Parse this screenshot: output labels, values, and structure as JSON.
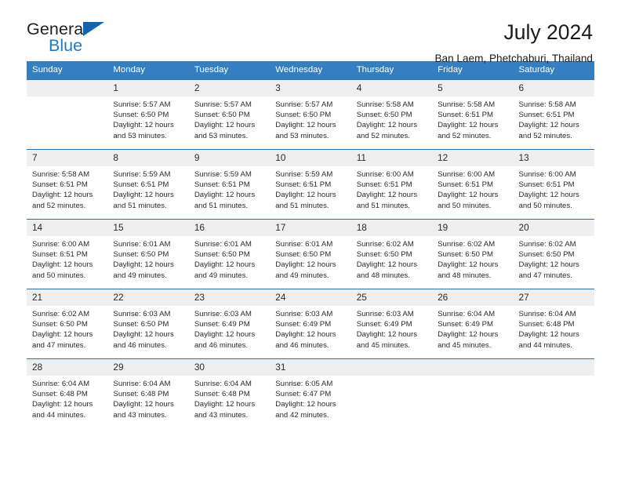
{
  "logo": {
    "word_one": "General",
    "word_two": "Blue",
    "triangle_color": "#1265ac",
    "blue_color": "#1f7ac4"
  },
  "header": {
    "title": "July 2024",
    "subtitle": "Ban Laem, Phetchaburi, Thailand"
  },
  "theme": {
    "header_blue": "#357ec0",
    "rule_blue": "#1f6bb0",
    "daynum_gray": "#efefef"
  },
  "weekdays": [
    "Sunday",
    "Monday",
    "Tuesday",
    "Wednesday",
    "Thursday",
    "Friday",
    "Saturday"
  ],
  "weeks": [
    [
      {
        "day": "",
        "text": ""
      },
      {
        "day": "1",
        "text": "Sunrise: 5:57 AM\nSunset: 6:50 PM\nDaylight: 12 hours\nand 53 minutes."
      },
      {
        "day": "2",
        "text": "Sunrise: 5:57 AM\nSunset: 6:50 PM\nDaylight: 12 hours\nand 53 minutes."
      },
      {
        "day": "3",
        "text": "Sunrise: 5:57 AM\nSunset: 6:50 PM\nDaylight: 12 hours\nand 53 minutes."
      },
      {
        "day": "4",
        "text": "Sunrise: 5:58 AM\nSunset: 6:50 PM\nDaylight: 12 hours\nand 52 minutes."
      },
      {
        "day": "5",
        "text": "Sunrise: 5:58 AM\nSunset: 6:51 PM\nDaylight: 12 hours\nand 52 minutes."
      },
      {
        "day": "6",
        "text": "Sunrise: 5:58 AM\nSunset: 6:51 PM\nDaylight: 12 hours\nand 52 minutes."
      }
    ],
    [
      {
        "day": "7",
        "text": "Sunrise: 5:58 AM\nSunset: 6:51 PM\nDaylight: 12 hours\nand 52 minutes."
      },
      {
        "day": "8",
        "text": "Sunrise: 5:59 AM\nSunset: 6:51 PM\nDaylight: 12 hours\nand 51 minutes."
      },
      {
        "day": "9",
        "text": "Sunrise: 5:59 AM\nSunset: 6:51 PM\nDaylight: 12 hours\nand 51 minutes."
      },
      {
        "day": "10",
        "text": "Sunrise: 5:59 AM\nSunset: 6:51 PM\nDaylight: 12 hours\nand 51 minutes."
      },
      {
        "day": "11",
        "text": "Sunrise: 6:00 AM\nSunset: 6:51 PM\nDaylight: 12 hours\nand 51 minutes."
      },
      {
        "day": "12",
        "text": "Sunrise: 6:00 AM\nSunset: 6:51 PM\nDaylight: 12 hours\nand 50 minutes."
      },
      {
        "day": "13",
        "text": "Sunrise: 6:00 AM\nSunset: 6:51 PM\nDaylight: 12 hours\nand 50 minutes."
      }
    ],
    [
      {
        "day": "14",
        "text": "Sunrise: 6:00 AM\nSunset: 6:51 PM\nDaylight: 12 hours\nand 50 minutes."
      },
      {
        "day": "15",
        "text": "Sunrise: 6:01 AM\nSunset: 6:50 PM\nDaylight: 12 hours\nand 49 minutes."
      },
      {
        "day": "16",
        "text": "Sunrise: 6:01 AM\nSunset: 6:50 PM\nDaylight: 12 hours\nand 49 minutes."
      },
      {
        "day": "17",
        "text": "Sunrise: 6:01 AM\nSunset: 6:50 PM\nDaylight: 12 hours\nand 49 minutes."
      },
      {
        "day": "18",
        "text": "Sunrise: 6:02 AM\nSunset: 6:50 PM\nDaylight: 12 hours\nand 48 minutes."
      },
      {
        "day": "19",
        "text": "Sunrise: 6:02 AM\nSunset: 6:50 PM\nDaylight: 12 hours\nand 48 minutes."
      },
      {
        "day": "20",
        "text": "Sunrise: 6:02 AM\nSunset: 6:50 PM\nDaylight: 12 hours\nand 47 minutes."
      }
    ],
    [
      {
        "day": "21",
        "text": "Sunrise: 6:02 AM\nSunset: 6:50 PM\nDaylight: 12 hours\nand 47 minutes."
      },
      {
        "day": "22",
        "text": "Sunrise: 6:03 AM\nSunset: 6:50 PM\nDaylight: 12 hours\nand 46 minutes."
      },
      {
        "day": "23",
        "text": "Sunrise: 6:03 AM\nSunset: 6:49 PM\nDaylight: 12 hours\nand 46 minutes."
      },
      {
        "day": "24",
        "text": "Sunrise: 6:03 AM\nSunset: 6:49 PM\nDaylight: 12 hours\nand 46 minutes."
      },
      {
        "day": "25",
        "text": "Sunrise: 6:03 AM\nSunset: 6:49 PM\nDaylight: 12 hours\nand 45 minutes."
      },
      {
        "day": "26",
        "text": "Sunrise: 6:04 AM\nSunset: 6:49 PM\nDaylight: 12 hours\nand 45 minutes."
      },
      {
        "day": "27",
        "text": "Sunrise: 6:04 AM\nSunset: 6:48 PM\nDaylight: 12 hours\nand 44 minutes."
      }
    ],
    [
      {
        "day": "28",
        "text": "Sunrise: 6:04 AM\nSunset: 6:48 PM\nDaylight: 12 hours\nand 44 minutes."
      },
      {
        "day": "29",
        "text": "Sunrise: 6:04 AM\nSunset: 6:48 PM\nDaylight: 12 hours\nand 43 minutes."
      },
      {
        "day": "30",
        "text": "Sunrise: 6:04 AM\nSunset: 6:48 PM\nDaylight: 12 hours\nand 43 minutes."
      },
      {
        "day": "31",
        "text": "Sunrise: 6:05 AM\nSunset: 6:47 PM\nDaylight: 12 hours\nand 42 minutes."
      },
      {
        "day": "",
        "text": ""
      },
      {
        "day": "",
        "text": ""
      },
      {
        "day": "",
        "text": ""
      }
    ]
  ]
}
